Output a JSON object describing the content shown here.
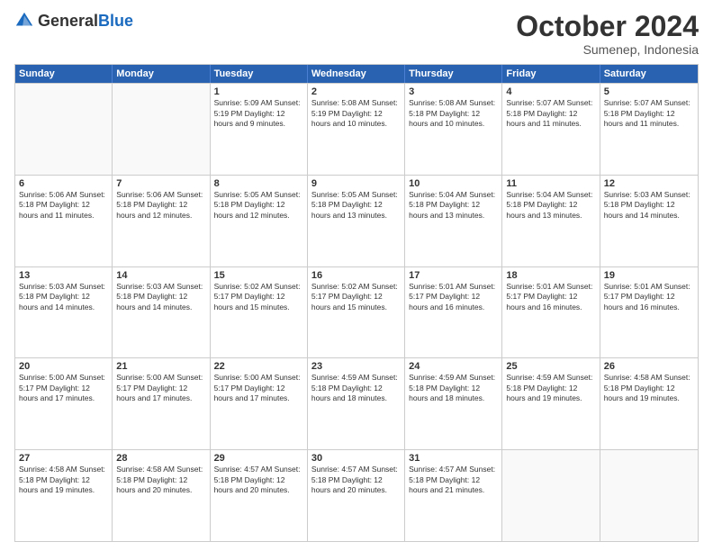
{
  "header": {
    "logo_general": "General",
    "logo_blue": "Blue",
    "month_year": "October 2024",
    "location": "Sumenep, Indonesia"
  },
  "days_of_week": [
    "Sunday",
    "Monday",
    "Tuesday",
    "Wednesday",
    "Thursday",
    "Friday",
    "Saturday"
  ],
  "weeks": [
    [
      {
        "day": "",
        "info": ""
      },
      {
        "day": "",
        "info": ""
      },
      {
        "day": "1",
        "info": "Sunrise: 5:09 AM\nSunset: 5:19 PM\nDaylight: 12 hours and 9 minutes."
      },
      {
        "day": "2",
        "info": "Sunrise: 5:08 AM\nSunset: 5:19 PM\nDaylight: 12 hours and 10 minutes."
      },
      {
        "day": "3",
        "info": "Sunrise: 5:08 AM\nSunset: 5:18 PM\nDaylight: 12 hours and 10 minutes."
      },
      {
        "day": "4",
        "info": "Sunrise: 5:07 AM\nSunset: 5:18 PM\nDaylight: 12 hours and 11 minutes."
      },
      {
        "day": "5",
        "info": "Sunrise: 5:07 AM\nSunset: 5:18 PM\nDaylight: 12 hours and 11 minutes."
      }
    ],
    [
      {
        "day": "6",
        "info": "Sunrise: 5:06 AM\nSunset: 5:18 PM\nDaylight: 12 hours and 11 minutes."
      },
      {
        "day": "7",
        "info": "Sunrise: 5:06 AM\nSunset: 5:18 PM\nDaylight: 12 hours and 12 minutes."
      },
      {
        "day": "8",
        "info": "Sunrise: 5:05 AM\nSunset: 5:18 PM\nDaylight: 12 hours and 12 minutes."
      },
      {
        "day": "9",
        "info": "Sunrise: 5:05 AM\nSunset: 5:18 PM\nDaylight: 12 hours and 13 minutes."
      },
      {
        "day": "10",
        "info": "Sunrise: 5:04 AM\nSunset: 5:18 PM\nDaylight: 12 hours and 13 minutes."
      },
      {
        "day": "11",
        "info": "Sunrise: 5:04 AM\nSunset: 5:18 PM\nDaylight: 12 hours and 13 minutes."
      },
      {
        "day": "12",
        "info": "Sunrise: 5:03 AM\nSunset: 5:18 PM\nDaylight: 12 hours and 14 minutes."
      }
    ],
    [
      {
        "day": "13",
        "info": "Sunrise: 5:03 AM\nSunset: 5:18 PM\nDaylight: 12 hours and 14 minutes."
      },
      {
        "day": "14",
        "info": "Sunrise: 5:03 AM\nSunset: 5:18 PM\nDaylight: 12 hours and 14 minutes."
      },
      {
        "day": "15",
        "info": "Sunrise: 5:02 AM\nSunset: 5:17 PM\nDaylight: 12 hours and 15 minutes."
      },
      {
        "day": "16",
        "info": "Sunrise: 5:02 AM\nSunset: 5:17 PM\nDaylight: 12 hours and 15 minutes."
      },
      {
        "day": "17",
        "info": "Sunrise: 5:01 AM\nSunset: 5:17 PM\nDaylight: 12 hours and 16 minutes."
      },
      {
        "day": "18",
        "info": "Sunrise: 5:01 AM\nSunset: 5:17 PM\nDaylight: 12 hours and 16 minutes."
      },
      {
        "day": "19",
        "info": "Sunrise: 5:01 AM\nSunset: 5:17 PM\nDaylight: 12 hours and 16 minutes."
      }
    ],
    [
      {
        "day": "20",
        "info": "Sunrise: 5:00 AM\nSunset: 5:17 PM\nDaylight: 12 hours and 17 minutes."
      },
      {
        "day": "21",
        "info": "Sunrise: 5:00 AM\nSunset: 5:17 PM\nDaylight: 12 hours and 17 minutes."
      },
      {
        "day": "22",
        "info": "Sunrise: 5:00 AM\nSunset: 5:17 PM\nDaylight: 12 hours and 17 minutes."
      },
      {
        "day": "23",
        "info": "Sunrise: 4:59 AM\nSunset: 5:18 PM\nDaylight: 12 hours and 18 minutes."
      },
      {
        "day": "24",
        "info": "Sunrise: 4:59 AM\nSunset: 5:18 PM\nDaylight: 12 hours and 18 minutes."
      },
      {
        "day": "25",
        "info": "Sunrise: 4:59 AM\nSunset: 5:18 PM\nDaylight: 12 hours and 19 minutes."
      },
      {
        "day": "26",
        "info": "Sunrise: 4:58 AM\nSunset: 5:18 PM\nDaylight: 12 hours and 19 minutes."
      }
    ],
    [
      {
        "day": "27",
        "info": "Sunrise: 4:58 AM\nSunset: 5:18 PM\nDaylight: 12 hours and 19 minutes."
      },
      {
        "day": "28",
        "info": "Sunrise: 4:58 AM\nSunset: 5:18 PM\nDaylight: 12 hours and 20 minutes."
      },
      {
        "day": "29",
        "info": "Sunrise: 4:57 AM\nSunset: 5:18 PM\nDaylight: 12 hours and 20 minutes."
      },
      {
        "day": "30",
        "info": "Sunrise: 4:57 AM\nSunset: 5:18 PM\nDaylight: 12 hours and 20 minutes."
      },
      {
        "day": "31",
        "info": "Sunrise: 4:57 AM\nSunset: 5:18 PM\nDaylight: 12 hours and 21 minutes."
      },
      {
        "day": "",
        "info": ""
      },
      {
        "day": "",
        "info": ""
      }
    ]
  ]
}
